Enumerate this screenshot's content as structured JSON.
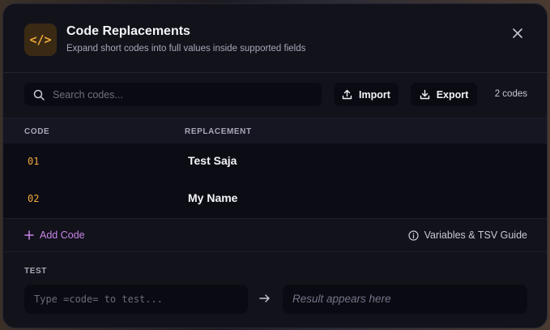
{
  "header": {
    "logo_glyph": "</>",
    "title": "Code Replacements",
    "subtitle": "Expand short codes into full values inside supported fields",
    "close_icon": "close-icon"
  },
  "toolbar": {
    "search_placeholder": "Search codes...",
    "import_label": "Import",
    "export_label": "Export",
    "count_text": "2 codes"
  },
  "table": {
    "headers": [
      "CODE",
      "REPLACEMENT"
    ],
    "rows": [
      {
        "code": "01",
        "replacement": "Test Saja"
      },
      {
        "code": "02",
        "replacement": "My Name"
      }
    ]
  },
  "actions": {
    "add_code_label": "Add Code",
    "guide_label": "Variables & TSV Guide"
  },
  "test": {
    "label": "TEST",
    "input_placeholder": "Type =code= to test...",
    "result_placeholder": "Result appears here"
  },
  "colors": {
    "accent_code": "#f2a93b",
    "accent_add": "#c985e6",
    "modal_bg": "#12121b"
  }
}
